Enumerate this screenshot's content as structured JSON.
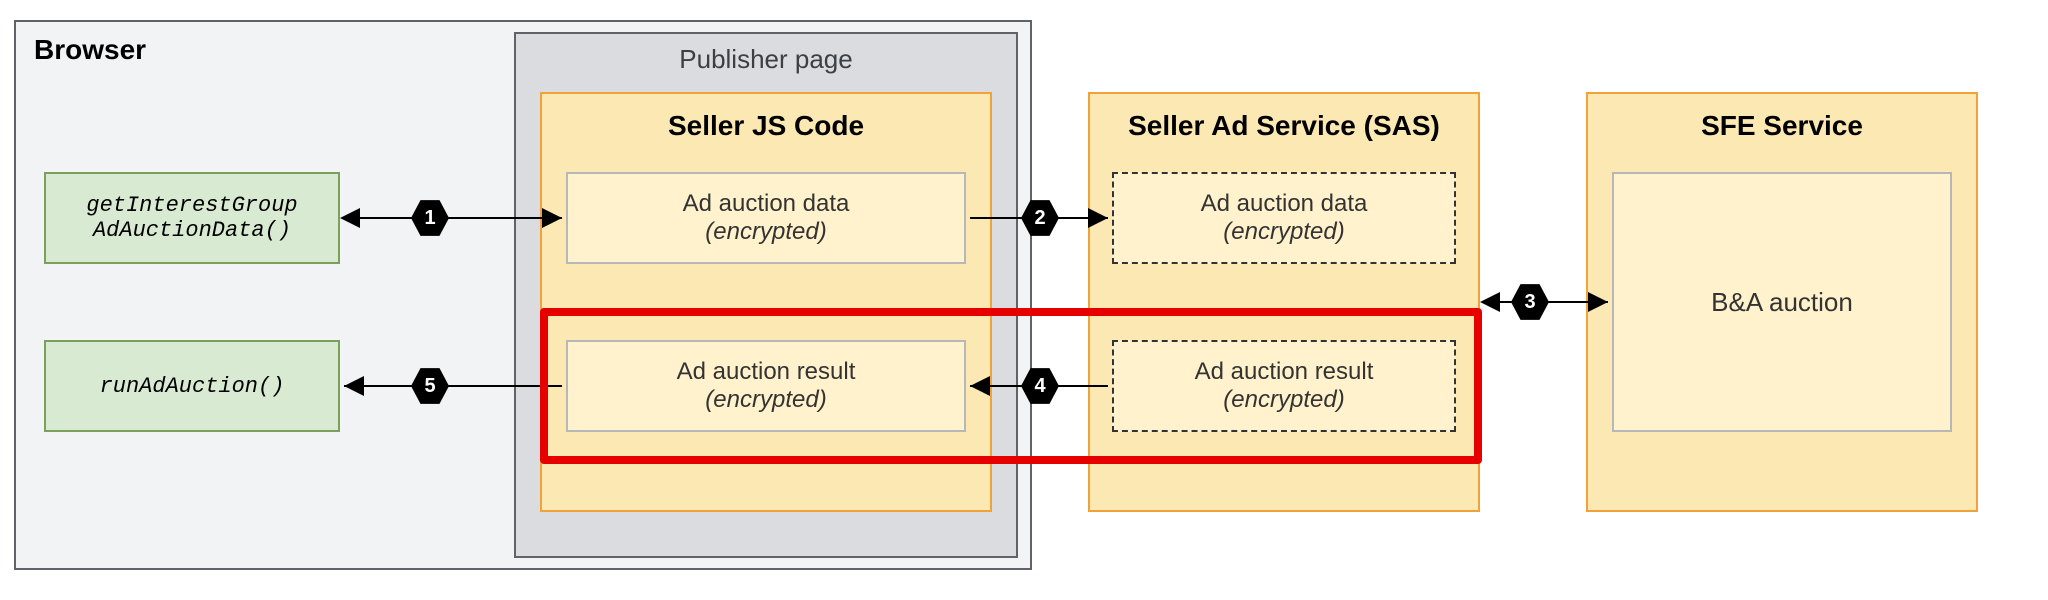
{
  "browser": {
    "title": "Browser"
  },
  "publisherPage": {
    "title": "Publisher page"
  },
  "sellerJs": {
    "title": "Seller JS Code"
  },
  "sas": {
    "title": "Seller Ad Service (SAS)"
  },
  "sfe": {
    "title": "SFE Service"
  },
  "api": {
    "getIG": "getInterestGroup",
    "getIGLine2": "AdAuctionData()",
    "runAuction": "runAdAuction()"
  },
  "cells": {
    "auctionData": "Ad auction data",
    "auctionResult": "Ad auction result",
    "encrypted": "(encrypted)",
    "baAuction": "B&A auction"
  },
  "steps": {
    "1": "1",
    "2": "2",
    "3": "3",
    "4": "4",
    "5": "5"
  }
}
